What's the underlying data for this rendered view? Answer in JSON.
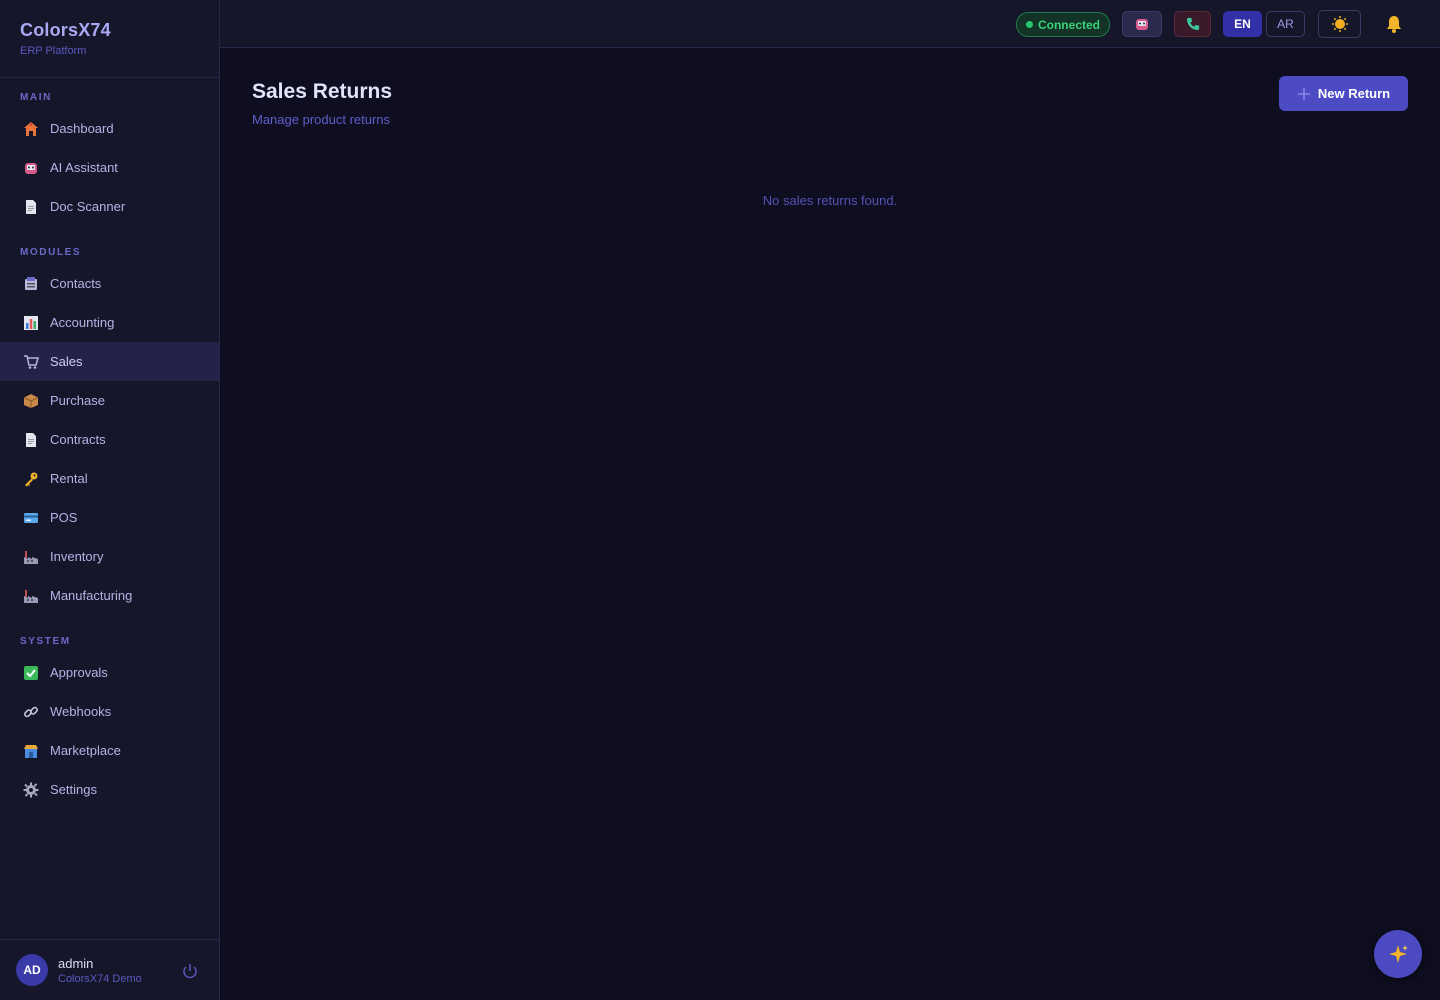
{
  "brand": {
    "title": "ColorsX74",
    "subtitle": "ERP Platform"
  },
  "sidebar": {
    "sections": [
      {
        "label": "MAIN",
        "items": [
          {
            "label": "Dashboard",
            "icon": "house-icon"
          },
          {
            "label": "AI Assistant",
            "icon": "robot-icon"
          },
          {
            "label": "Doc Scanner",
            "icon": "document-icon"
          }
        ]
      },
      {
        "label": "MODULES",
        "items": [
          {
            "label": "Contacts",
            "icon": "contacts-icon"
          },
          {
            "label": "Accounting",
            "icon": "chart-icon"
          },
          {
            "label": "Sales",
            "icon": "cart-icon",
            "active": true
          },
          {
            "label": "Purchase",
            "icon": "package-icon"
          },
          {
            "label": "Contracts",
            "icon": "document-icon"
          },
          {
            "label": "Rental",
            "icon": "key-icon"
          },
          {
            "label": "POS",
            "icon": "card-icon"
          },
          {
            "label": "Inventory",
            "icon": "factory-icon"
          },
          {
            "label": "Manufacturing",
            "icon": "factory-icon"
          }
        ]
      },
      {
        "label": "SYSTEM",
        "items": [
          {
            "label": "Approvals",
            "icon": "check-icon"
          },
          {
            "label": "Webhooks",
            "icon": "link-icon"
          },
          {
            "label": "Marketplace",
            "icon": "store-icon"
          },
          {
            "label": "Settings",
            "icon": "gear-icon"
          }
        ]
      }
    ]
  },
  "user": {
    "initials": "AD",
    "name": "admin",
    "org": "ColorsX74 Demo"
  },
  "topbar": {
    "status": "Connected",
    "lang_en": "EN",
    "lang_ar": "AR"
  },
  "page": {
    "title": "Sales Returns",
    "subtitle": "Manage product returns",
    "new_button": "New Return",
    "empty_message": "No sales returns found."
  },
  "colors": {
    "accent": "#4d4bc4",
    "status_green": "#28c76f",
    "background": "#0e0e20",
    "sidebar": "#16162a"
  }
}
